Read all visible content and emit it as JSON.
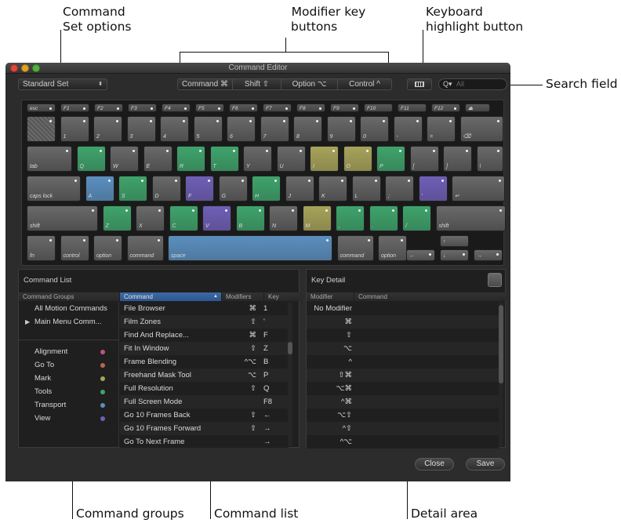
{
  "callouts": {
    "command_set_1": "Command",
    "command_set_2": "Set options",
    "modifier_1": "Modifier key",
    "modifier_2": "buttons",
    "keyboard_1": "Keyboard",
    "keyboard_2": "highlight button",
    "search": "Search field",
    "groups": "Command groups",
    "list": "Command list",
    "detail": "Detail area"
  },
  "window": {
    "title": "Command Editor",
    "command_set": "Standard Set",
    "modifiers": [
      "Command ⌘",
      "Shift ⇧",
      "Option ⌥",
      "Control ^"
    ],
    "search_placeholder": "All",
    "search_icon": "magnifier-icon",
    "keyboard_icon": "keyboard-icon"
  },
  "colors": {
    "green": "#3fa36b",
    "blue": "#5b8fbf",
    "purple": "#6f5fb7",
    "olive": "#a7a35a",
    "gray": "#5a5a5a"
  },
  "keyboard": {
    "frow": [
      {
        "l": "esc",
        "dot": true
      },
      {
        "l": "F1",
        "dot": true
      },
      {
        "l": "F2",
        "dot": true
      },
      {
        "l": "F3",
        "dot": true
      },
      {
        "l": "F4",
        "dot": true
      },
      {
        "l": "F5",
        "dot": true
      },
      {
        "l": "F6",
        "dot": true
      },
      {
        "l": "F7",
        "dot": true
      },
      {
        "l": "F8",
        "dot": true
      },
      {
        "l": "F9",
        "dot": true
      },
      {
        "l": "F10",
        "dot": false
      },
      {
        "l": "F11",
        "dot": false
      },
      {
        "l": "F12",
        "dot": true
      },
      {
        "l": "⏏",
        "dot": false
      }
    ],
    "row1": [
      {
        "l": "",
        "c": "gray"
      },
      {
        "l": "1",
        "c": ""
      },
      {
        "l": "2",
        "c": ""
      },
      {
        "l": "3",
        "c": ""
      },
      {
        "l": "4",
        "c": ""
      },
      {
        "l": "5",
        "c": ""
      },
      {
        "l": "6",
        "c": ""
      },
      {
        "l": "7",
        "c": ""
      },
      {
        "l": "8",
        "c": ""
      },
      {
        "l": "9",
        "c": ""
      },
      {
        "l": "0",
        "c": ""
      },
      {
        "l": "-",
        "c": ""
      },
      {
        "l": "=",
        "c": ""
      },
      {
        "l": "⌫",
        "c": ""
      }
    ],
    "row2": [
      {
        "l": "tab",
        "c": ""
      },
      {
        "l": "Q",
        "c": "green"
      },
      {
        "l": "W",
        "c": ""
      },
      {
        "l": "E",
        "c": ""
      },
      {
        "l": "R",
        "c": "green"
      },
      {
        "l": "T",
        "c": "green"
      },
      {
        "l": "Y",
        "c": ""
      },
      {
        "l": "U",
        "c": ""
      },
      {
        "l": "I",
        "c": "olive"
      },
      {
        "l": "O",
        "c": "olive"
      },
      {
        "l": "P",
        "c": "green"
      },
      {
        "l": "[",
        "c": ""
      },
      {
        "l": "]",
        "c": ""
      },
      {
        "l": "\\",
        "c": ""
      }
    ],
    "row3": [
      {
        "l": "caps lock",
        "c": ""
      },
      {
        "l": "A",
        "c": "blue"
      },
      {
        "l": "S",
        "c": "green"
      },
      {
        "l": "D",
        "c": ""
      },
      {
        "l": "F",
        "c": "purple"
      },
      {
        "l": "G",
        "c": ""
      },
      {
        "l": "H",
        "c": "green"
      },
      {
        "l": "J",
        "c": ""
      },
      {
        "l": "K",
        "c": ""
      },
      {
        "l": "L",
        "c": ""
      },
      {
        "l": ";",
        "c": ""
      },
      {
        "l": "'",
        "c": "purple"
      },
      {
        "l": "↵",
        "c": ""
      }
    ],
    "row4": [
      {
        "l": "shift",
        "c": ""
      },
      {
        "l": "Z",
        "c": "green"
      },
      {
        "l": "X",
        "c": ""
      },
      {
        "l": "C",
        "c": "green"
      },
      {
        "l": "V",
        "c": "purple"
      },
      {
        "l": "B",
        "c": "green"
      },
      {
        "l": "N",
        "c": ""
      },
      {
        "l": "M",
        "c": "olive"
      },
      {
        "l": ",",
        "c": "green"
      },
      {
        "l": ".",
        "c": "green"
      },
      {
        "l": "/",
        "c": "green"
      },
      {
        "l": "shift",
        "c": ""
      }
    ],
    "row5": [
      {
        "l": "fn",
        "c": ""
      },
      {
        "l": "control",
        "c": ""
      },
      {
        "l": "option",
        "c": ""
      },
      {
        "l": "command",
        "c": ""
      },
      {
        "l": "space",
        "c": "blue"
      },
      {
        "l": "command",
        "c": ""
      },
      {
        "l": "option",
        "c": ""
      }
    ],
    "arrows": [
      "↑",
      "←",
      "↓",
      "→"
    ]
  },
  "command_list": {
    "title": "Command List",
    "groups_header": "Command Groups",
    "groups_top": [
      "All Motion Commands",
      "Main Menu Comm..."
    ],
    "groups": [
      {
        "name": "Alignment",
        "color": "#c2508a"
      },
      {
        "name": "Go To",
        "color": "#b7674f"
      },
      {
        "name": "Mark",
        "color": "#a7a35a"
      },
      {
        "name": "Tools",
        "color": "#3fa36b"
      },
      {
        "name": "Transport",
        "color": "#5b8fbf"
      },
      {
        "name": "View",
        "color": "#6f5fb7"
      }
    ],
    "headers": {
      "command": "Command",
      "modifiers": "Modifiers",
      "key": "Key"
    },
    "rows": [
      {
        "name": "File Browser",
        "mod": "⌘",
        "key": "1"
      },
      {
        "name": "Film Zones",
        "mod": "⇧",
        "key": "'"
      },
      {
        "name": "Find And Replace...",
        "mod": "⌘",
        "key": "F"
      },
      {
        "name": "Fit In Window",
        "mod": "⇧",
        "key": "Z"
      },
      {
        "name": "Frame Blending",
        "mod": "^⌥",
        "key": "B"
      },
      {
        "name": "Freehand Mask Tool",
        "mod": "⌥",
        "key": "P"
      },
      {
        "name": "Full Resolution",
        "mod": "⇧",
        "key": "Q"
      },
      {
        "name": "Full Screen Mode",
        "mod": "",
        "key": "F8"
      },
      {
        "name": "Go 10 Frames Back",
        "mod": "⇧",
        "key": "←"
      },
      {
        "name": "Go 10 Frames Forward",
        "mod": "⇧",
        "key": "→"
      },
      {
        "name": "Go To Next Frame",
        "mod": "",
        "key": "→"
      }
    ]
  },
  "key_detail": {
    "title": "Key Detail",
    "headers": {
      "modifier": "Modifier",
      "command": "Command"
    },
    "rows": [
      "No Modifier",
      "⌘",
      "⇧",
      "⌥",
      "^",
      "⇧⌘",
      "⌥⌘",
      "^⌘",
      "⌥⇧",
      "^⇧",
      "^⌥"
    ]
  },
  "buttons": {
    "close": "Close",
    "save": "Save"
  }
}
